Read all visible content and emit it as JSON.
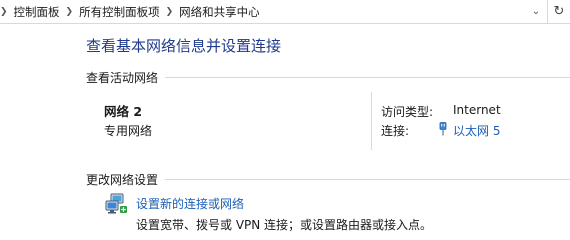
{
  "addressbar": {
    "crumbs": [
      "控制面板",
      "所有控制面板项",
      "网络和共享中心"
    ],
    "dropdown_icon": "chevron-down-icon",
    "refresh_icon": "refresh-icon"
  },
  "main": {
    "title": "查看基本网络信息并设置连接",
    "active_networks": {
      "heading": "查看活动网络",
      "network_name": "网络 2",
      "network_type": "专用网络",
      "access_type_label": "访问类型:",
      "access_type_value": "Internet",
      "connections_label": "连接:",
      "connections_value": "以太网 5"
    },
    "change_settings": {
      "heading": "更改网络设置",
      "tasks": [
        {
          "link": "设置新的连接或网络",
          "description": "设置宽带、拨号或 VPN 连接；或设置路由器或接入点。",
          "icon": "network-setup-icon"
        }
      ]
    }
  },
  "colors": {
    "title": "#1f3b8c",
    "link": "#1a5fb4",
    "separator": "#d9d9d9"
  }
}
